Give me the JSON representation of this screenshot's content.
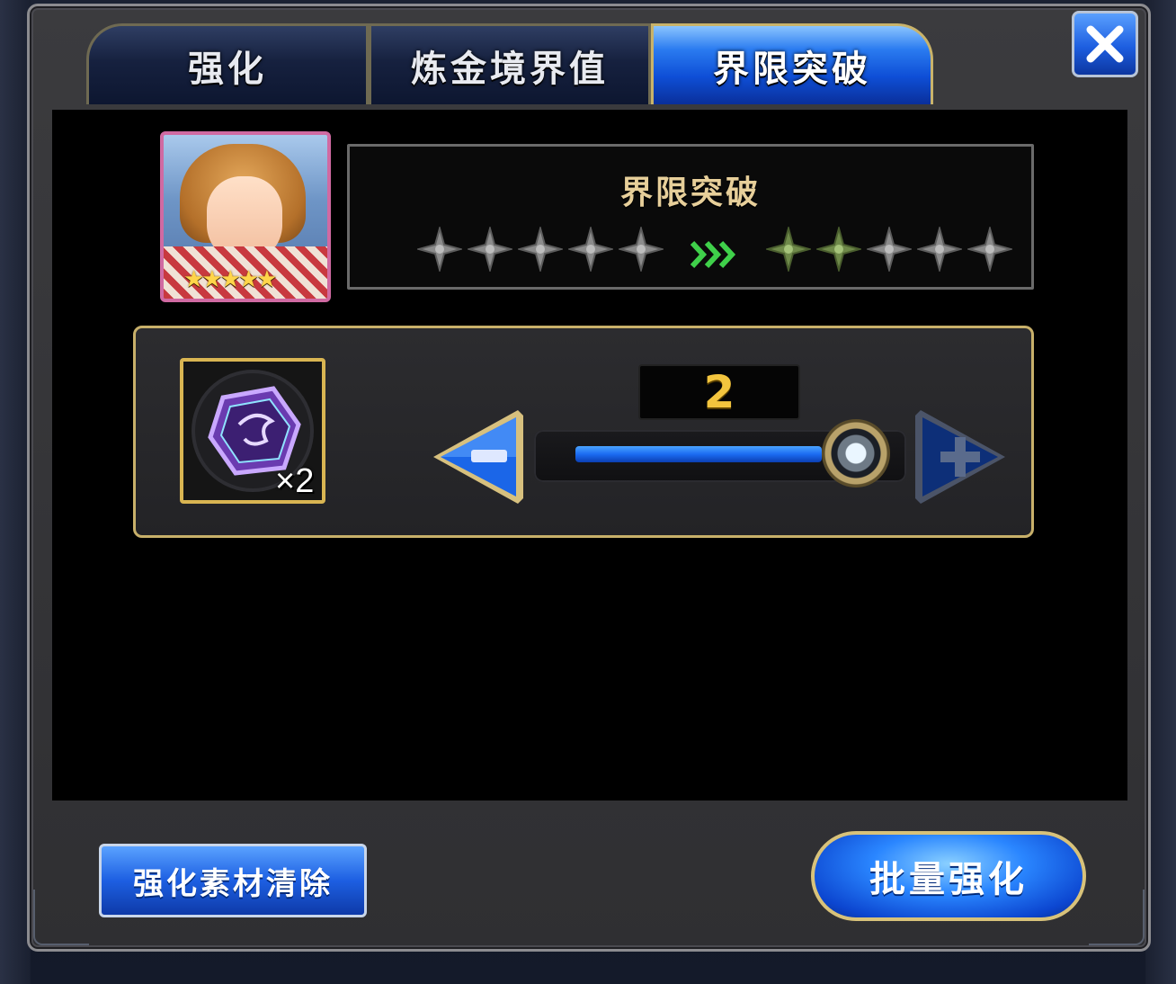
{
  "tabs": [
    {
      "label": "强化",
      "active": false
    },
    {
      "label": "炼金境界值",
      "active": false
    },
    {
      "label": "界限突破",
      "active": true
    }
  ],
  "close": {
    "icon": "close-icon"
  },
  "character": {
    "rarity_stars": 5
  },
  "limit_break": {
    "title": "界限突破",
    "current_marks": 5,
    "next_marks_highlighted": 2,
    "next_marks_total": 5
  },
  "material": {
    "count_label": "×2"
  },
  "slider": {
    "value": "2",
    "fraction": 0.76
  },
  "buttons": {
    "clear_label": "强化素材清除",
    "batch_label": "批量强化"
  },
  "colors": {
    "accent_blue": "#1d5fe2",
    "gold_border": "#c8b06a",
    "value_gold": "#f3c53e"
  }
}
